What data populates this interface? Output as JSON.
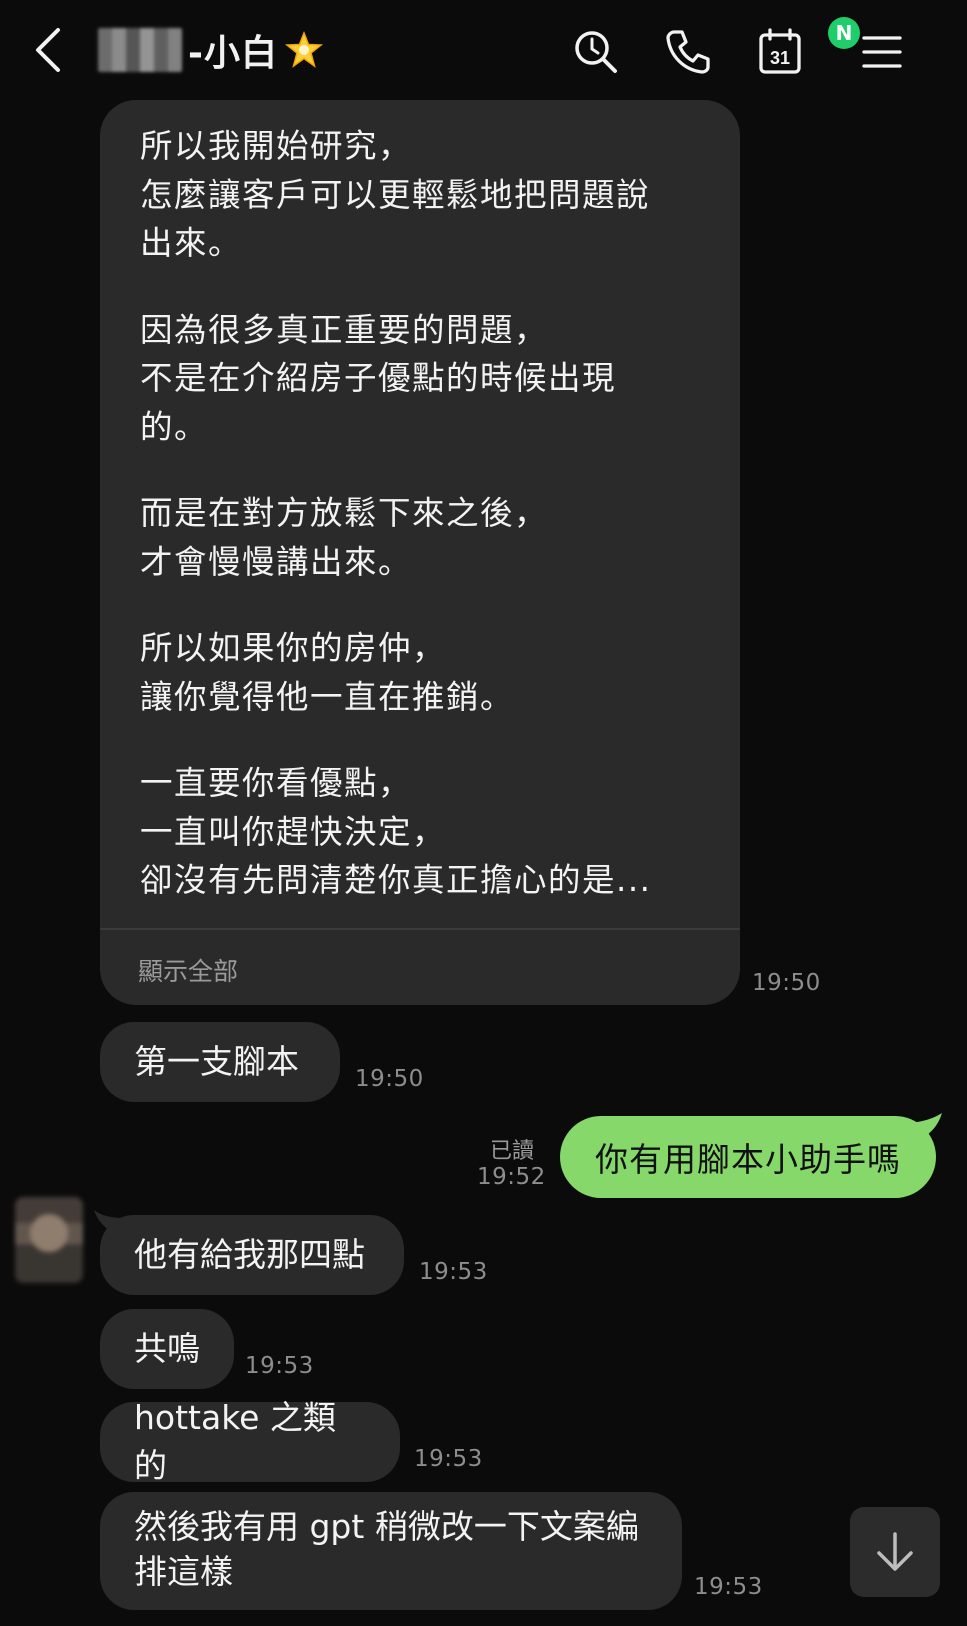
{
  "header": {
    "contact_name": "-小白",
    "back_icon": "chevron-left-icon",
    "search_icon": "search-icon",
    "call_icon": "phone-icon",
    "calendar_icon": "calendar-icon",
    "calendar_day": "31",
    "calendar_badge": "N",
    "menu_icon": "menu-icon",
    "star_emoji": "star-icon"
  },
  "messages": {
    "long": {
      "paragraphs": [
        [
          "所以我開始研究，",
          "怎麼讓客戶可以更輕鬆地把問題說",
          "出來。"
        ],
        [
          "因為很多真正重要的問題，",
          "不是在介紹房子優點的時候出現",
          "的。"
        ],
        [
          "而是在對方放鬆下來之後，",
          "才會慢慢講出來。"
        ],
        [
          "所以如果你的房仲，",
          "讓你覺得他一直在推銷。"
        ],
        [
          "一直要你看優點，",
          "一直叫你趕快決定，",
          "卻沒有先問清楚你真正擔心的是..."
        ]
      ],
      "show_all": "顯示全部",
      "time": "19:50"
    },
    "m1": {
      "text": "第一支腳本",
      "time": "19:50"
    },
    "m2": {
      "text": "你有用腳本小助手嗎",
      "read": "已讀",
      "time": "19:52"
    },
    "m3": {
      "text": "他有給我那四點",
      "time": "19:53"
    },
    "m4": {
      "text": "共鳴",
      "time": "19:53"
    },
    "m5": {
      "text": "hottake 之類的",
      "time": "19:53"
    },
    "m6": {
      "line1": "然後我有用 gpt 稍微改一下文案編",
      "line2": "排這樣",
      "time": "19:53"
    }
  },
  "colors": {
    "background": "#0b0b0b",
    "bubble_incoming": "#2a2a2a",
    "bubble_outgoing": "#86d86b",
    "badge": "#1fce6a"
  }
}
